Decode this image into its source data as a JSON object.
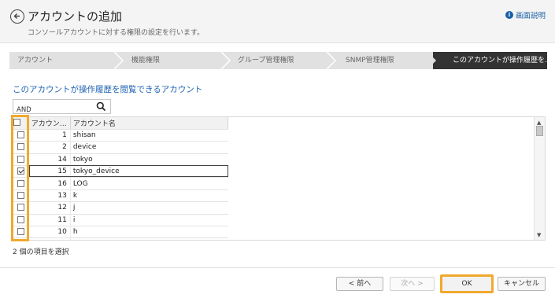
{
  "header": {
    "title": "アカウントの追加",
    "subtitle": "コンソールアカウントに対する権限の設定を行います。",
    "help_label": "画面説明"
  },
  "steps": [
    {
      "label": "アカウント"
    },
    {
      "label": "機能権限"
    },
    {
      "label": "グループ管理権限"
    },
    {
      "label": "SNMP管理権限"
    },
    {
      "label": "このアカウントが操作履歴を…",
      "active": true
    }
  ],
  "section": {
    "title": "このアカウントが操作履歴を閲覧できるアカウント"
  },
  "search": {
    "value": "AND",
    "placeholder": ""
  },
  "table": {
    "columns": [
      "アカウン…",
      "アカウント名"
    ],
    "rows": [
      {
        "id": "1",
        "name": "shisan",
        "checked": false
      },
      {
        "id": "2",
        "name": "device",
        "checked": false
      },
      {
        "id": "14",
        "name": "tokyo",
        "checked": false
      },
      {
        "id": "15",
        "name": "tokyo_device",
        "checked": true
      },
      {
        "id": "16",
        "name": "LOG",
        "checked": false
      },
      {
        "id": "13",
        "name": "k",
        "checked": false
      },
      {
        "id": "12",
        "name": "j",
        "checked": false
      },
      {
        "id": "11",
        "name": "i",
        "checked": false
      },
      {
        "id": "10",
        "name": "h",
        "checked": false
      }
    ]
  },
  "status": {
    "text": "2 個の項目を選択"
  },
  "footer": {
    "prev_label": "< 前へ",
    "next_label": "次へ >",
    "ok_label": "OK",
    "cancel_label": "キャンセル"
  },
  "colors": {
    "accent": "#1d62b3",
    "highlight": "#f0a92d",
    "active_step": "#333333"
  }
}
